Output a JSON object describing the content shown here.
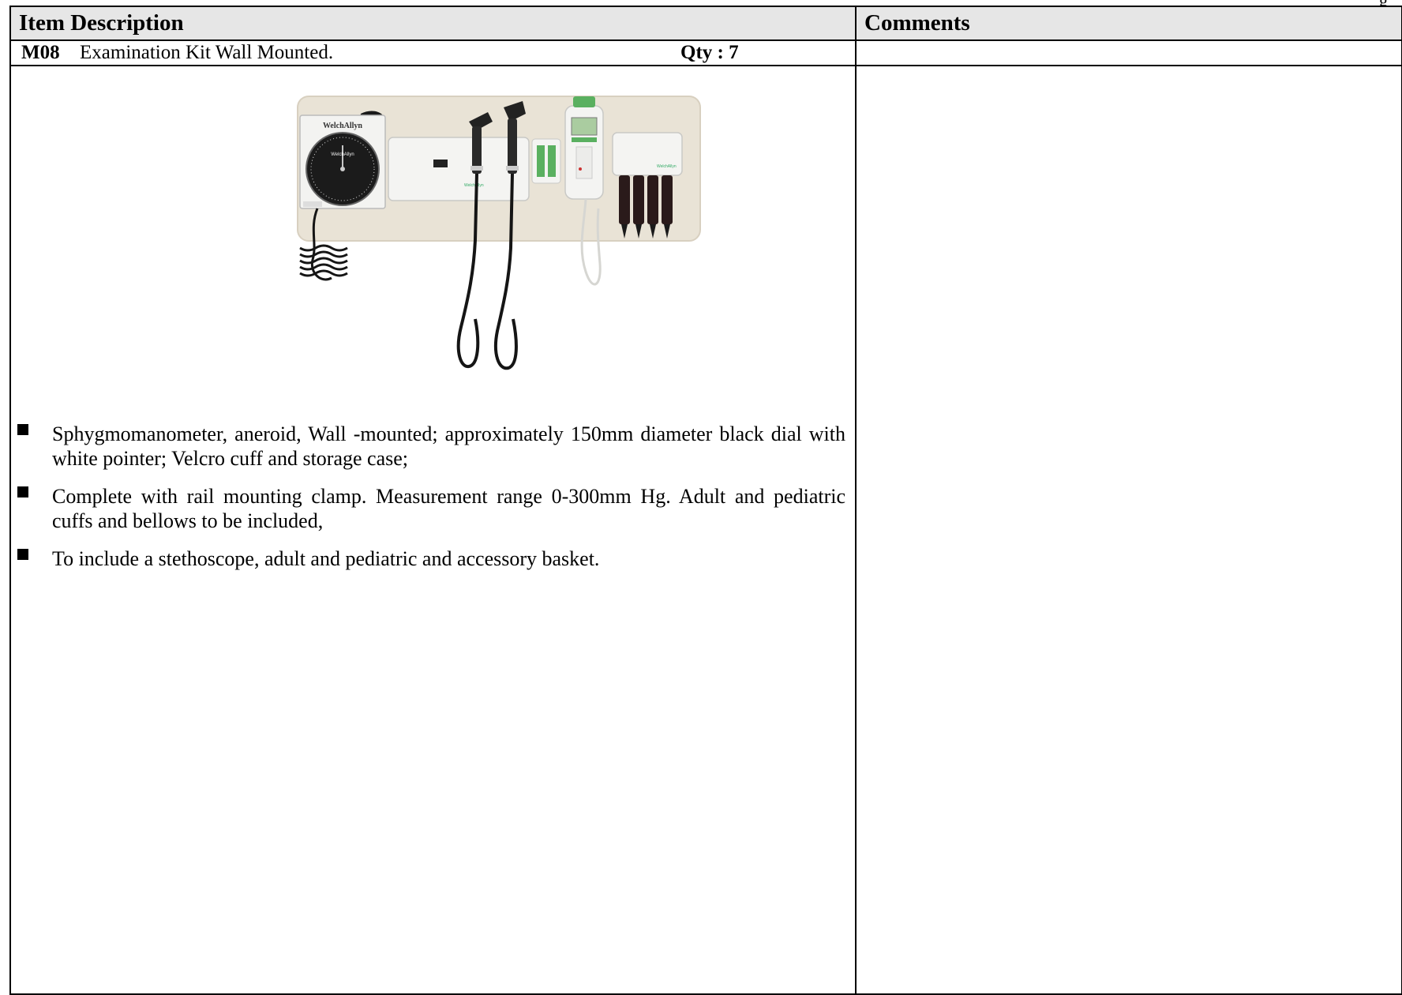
{
  "page": {
    "top_right_fragment": "g"
  },
  "table": {
    "headers": {
      "description": "Item Description",
      "comments": "Comments"
    },
    "item": {
      "code": "M08",
      "title": "Examination Kit Wall Mounted.",
      "qty": "Qty : 7"
    },
    "bullets": [
      "Sphygmomanometer, aneroid, Wall -mounted; approximately 150mm diameter black dial with white pointer; Velcro cuff and storage case;",
      "Complete with rail mounting clamp. Measurement range 0-300mm Hg. Adult and pediatric cuffs and bellows to be included,",
      "To include a stethoscope, adult and pediatric and accessory basket."
    ],
    "comments_text": ""
  },
  "figure": {
    "brand": "WelchAllyn",
    "dial_numbers": [
      "120",
      "140",
      "160",
      "180",
      "200",
      "220",
      "240",
      "260",
      "280",
      "300",
      "20",
      "40",
      "60",
      "80",
      "100"
    ],
    "dial_brand": "WelchAllyn",
    "colors": {
      "panel": "#e9e3d6",
      "dial_face": "#1b1b1b",
      "dial_bezel": "#ededed",
      "device_white": "#f4f4f2",
      "accent_green": "#5ab060",
      "cable_black": "#151515"
    }
  }
}
